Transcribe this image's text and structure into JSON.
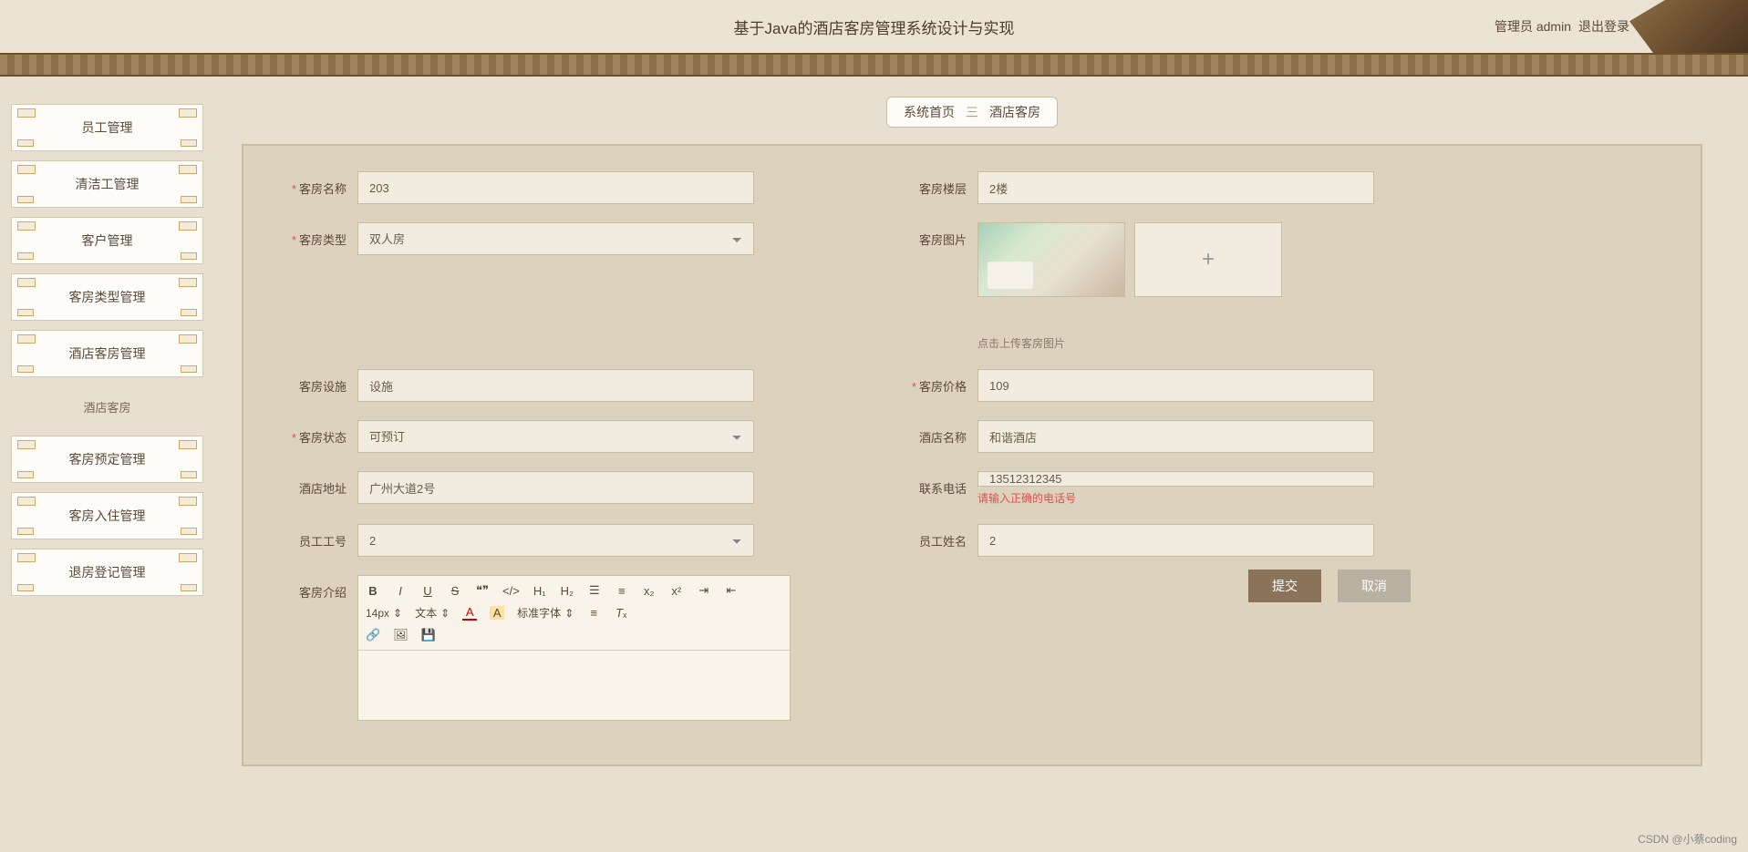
{
  "header": {
    "title": "基于Java的酒店客房管理系统设计与实现",
    "admin_label": "管理员 admin",
    "logout_label": "退出登录"
  },
  "sidebar": {
    "items": [
      {
        "label": "员工管理"
      },
      {
        "label": "清洁工管理"
      },
      {
        "label": "客户管理"
      },
      {
        "label": "客房类型管理"
      },
      {
        "label": "酒店客房管理"
      }
    ],
    "sub_item": "酒店客房",
    "items2": [
      {
        "label": "客房预定管理"
      },
      {
        "label": "客房入住管理"
      },
      {
        "label": "退房登记管理"
      }
    ]
  },
  "tabs": {
    "home": "系统首页",
    "current": "酒店客房"
  },
  "form": {
    "room_name": {
      "label": "客房名称",
      "value": "203"
    },
    "room_floor": {
      "label": "客房楼层",
      "value": "2楼"
    },
    "room_type": {
      "label": "客房类型",
      "value": "双人房"
    },
    "room_image": {
      "label": "客房图片",
      "hint": "点击上传客房图片"
    },
    "room_facility": {
      "label": "客房设施",
      "value": "设施"
    },
    "room_price": {
      "label": "客房价格",
      "value": "109"
    },
    "room_status": {
      "label": "客房状态",
      "value": "可预订"
    },
    "hotel_name": {
      "label": "酒店名称",
      "value": "和谐酒店"
    },
    "hotel_addr": {
      "label": "酒店地址",
      "value": "广州大道2号"
    },
    "phone": {
      "label": "联系电话",
      "value": "13512312345",
      "error": "请输入正确的电话号"
    },
    "emp_id": {
      "label": "员工工号",
      "value": "2"
    },
    "emp_name": {
      "label": "员工姓名",
      "value": "2"
    },
    "room_intro": {
      "label": "客房介绍"
    }
  },
  "editor": {
    "font_size": "14px",
    "text_label": "文本",
    "font_label": "标准字体"
  },
  "buttons": {
    "submit": "提交",
    "cancel": "取消"
  },
  "watermark": "CSDN @小蔡coding"
}
